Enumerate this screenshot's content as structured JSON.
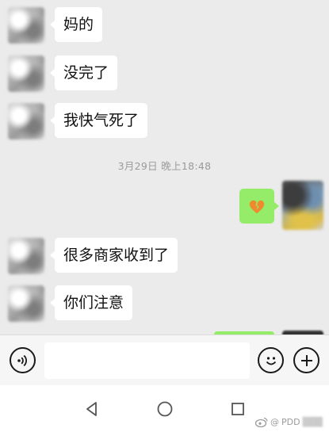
{
  "messages": [
    {
      "side": "left",
      "text": "妈的"
    },
    {
      "side": "left",
      "text": "没完了"
    },
    {
      "side": "left",
      "text": "我快气死了"
    },
    {
      "side": "right",
      "emoji": "broken-heart-icon"
    },
    {
      "side": "left",
      "text": "很多商家收到了"
    },
    {
      "side": "left",
      "text": "你们注意"
    }
  ],
  "timestamp": "3月29日 晚上18:48",
  "input": {
    "placeholder": ""
  },
  "watermark": {
    "prefix": "@",
    "handle": "PDD"
  },
  "icons": {
    "voice": "voice-icon",
    "emoji": "emoji-icon",
    "plus": "plus-icon",
    "back": "nav-back-icon",
    "home": "nav-home-icon",
    "recents": "nav-recents-icon",
    "weibo": "weibo-logo-icon"
  },
  "colors": {
    "background": "#ebebeb",
    "bubble_left": "#ffffff",
    "bubble_right": "#95ec69",
    "timestamp": "#9a9a9a",
    "heart": "#f08a2c"
  }
}
